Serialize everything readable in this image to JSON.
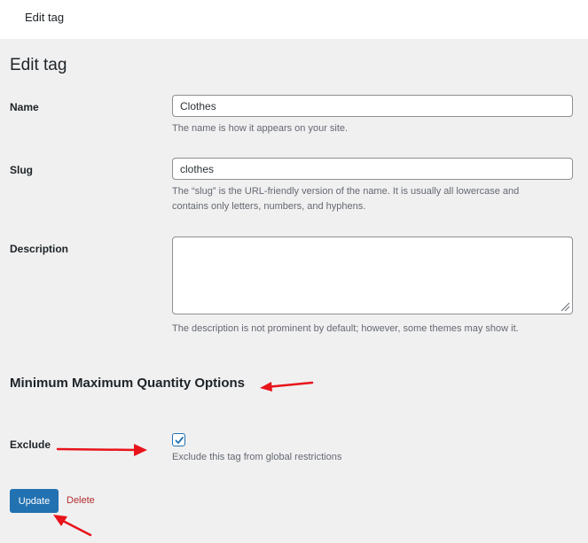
{
  "header": {
    "title": "Edit tag"
  },
  "page": {
    "title": "Edit tag"
  },
  "fields": {
    "name": {
      "label": "Name",
      "value": "Clothes",
      "help": "The name is how it appears on your site."
    },
    "slug": {
      "label": "Slug",
      "value": "clothes",
      "help": "The “slug” is the URL-friendly version of the name. It is usually all lowercase and contains only letters, numbers, and hyphens."
    },
    "description": {
      "label": "Description",
      "value": "",
      "help": "The description is not prominent by default; however, some themes may show it."
    }
  },
  "quantity_options": {
    "heading": "Minimum Maximum Quantity Options",
    "exclude": {
      "label": "Exclude",
      "checked": true,
      "help": "Exclude this tag from global restrictions"
    }
  },
  "actions": {
    "update_label": "Update",
    "delete_label": "Delete"
  },
  "colors": {
    "accent": "#2271b1",
    "delete": "#b32d2e",
    "annotation_arrow": "#e8141b"
  }
}
